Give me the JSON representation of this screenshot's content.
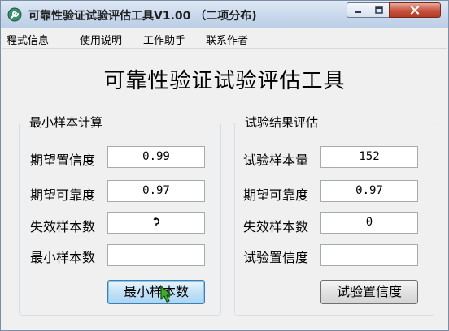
{
  "window": {
    "title": "可靠性验证试验评估工具V1.00 （二项分布)",
    "icon": "app-wrench-icon",
    "controls": [
      "minimize-icon",
      "maximize-icon",
      "close-icon"
    ]
  },
  "menu": {
    "items": [
      "程式信息",
      "使用说明",
      "工作助手",
      "联系作者"
    ]
  },
  "heading": "可靠性验证试验评估工具",
  "min_sample": {
    "title": "最小样本计算",
    "rows": [
      {
        "label": "期望置信度",
        "value": "0.99"
      },
      {
        "label": "期望可靠度",
        "value": "0.97"
      },
      {
        "label": "失效样本数",
        "value": ""
      },
      {
        "label": "最小样本数",
        "value": ""
      }
    ],
    "button_label": "最小样本数"
  },
  "evaluation": {
    "title": "试验结果评估",
    "rows": [
      {
        "label": "试验样本量",
        "value": "152"
      },
      {
        "label": "期望可靠度",
        "value": "0.97"
      },
      {
        "label": "失效样本数",
        "value": "0"
      },
      {
        "label": "试验置信度",
        "value": ""
      }
    ],
    "button_label": "试验置信度"
  },
  "colors": {
    "title_bar": "#c9d8ec",
    "close_button": "#c5513b",
    "hover_button": "#c4e2f7"
  }
}
